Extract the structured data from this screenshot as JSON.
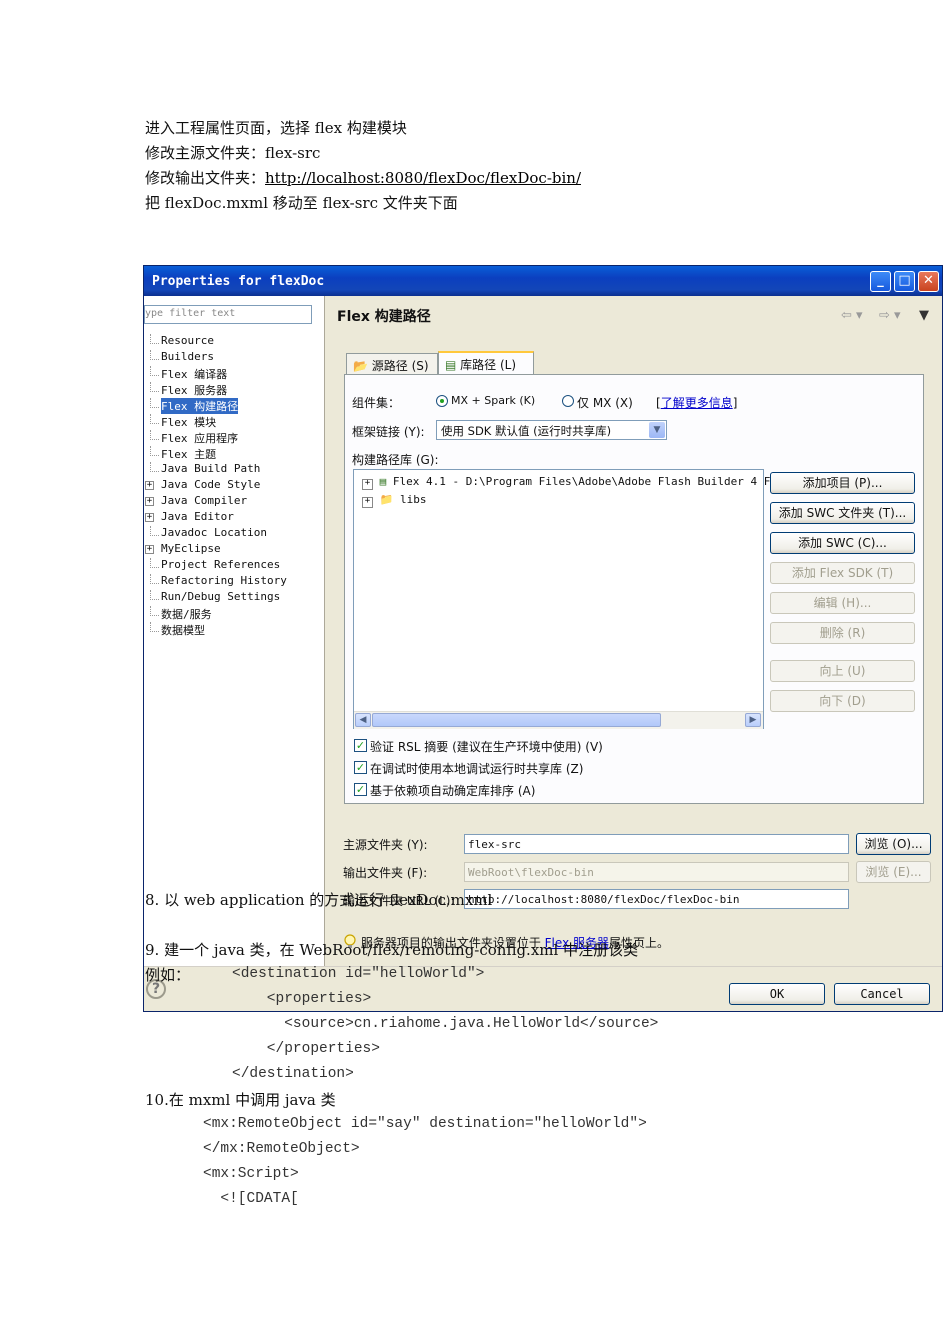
{
  "intro_lines": [
    "进入工程属性页面，选择 flex 构建模块",
    "修改主源文件夹：flex-src",
    "修改输出文件夹：",
    "把 flexDoc.mxml 移动至 flex-src 文件夹下面"
  ],
  "output_url": "http://localhost:8080/flexDoc/flexDoc-bin/",
  "dialog": {
    "title": "Properties for flexDoc",
    "filter_placeholder": "ype filter text",
    "tree": [
      {
        "label": "Resource",
        "expandable": false
      },
      {
        "label": "Builders",
        "expandable": false
      },
      {
        "label": "Flex 编译器",
        "expandable": false
      },
      {
        "label": "Flex 服务器",
        "expandable": false
      },
      {
        "label": "Flex 构建路径",
        "expandable": false,
        "selected": true
      },
      {
        "label": "Flex 模块",
        "expandable": false
      },
      {
        "label": "Flex 应用程序",
        "expandable": false
      },
      {
        "label": "Flex 主题",
        "expandable": false
      },
      {
        "label": "Java Build Path",
        "expandable": false
      },
      {
        "label": "Java Code Style",
        "expandable": true
      },
      {
        "label": "Java Compiler",
        "expandable": true
      },
      {
        "label": "Java Editor",
        "expandable": true
      },
      {
        "label": "Javadoc Location",
        "expandable": false
      },
      {
        "label": "MyEclipse",
        "expandable": true
      },
      {
        "label": "Project References",
        "expandable": false
      },
      {
        "label": "Refactoring History",
        "expandable": false
      },
      {
        "label": "Run/Debug Settings",
        "expandable": false
      },
      {
        "label": "数据/服务",
        "expandable": false
      },
      {
        "label": "数据模型",
        "expandable": false
      }
    ],
    "header": "Flex 构建路径",
    "tabs": [
      "源路径 (S)",
      "库路径 (L)"
    ],
    "component_set_label": "组件集：",
    "radio_mx_spark": "MX + Spark (K)",
    "radio_mx_only": "仅 MX (X)",
    "learn_more": "了解更多信息",
    "framework_link_label": "框架链接 (Y):",
    "framework_link_value": "使用 SDK 默认值 (运行时共享库)",
    "lib_label": "构建路径库 (G):",
    "lib_items": [
      "Flex 4.1 - D:\\Program Files\\Adobe\\Adobe Flash Builder 4 F",
      "libs"
    ],
    "buttons": [
      {
        "label": "添加项目 (P)...",
        "enabled": true
      },
      {
        "label": "添加 SWC 文件夹 (T)...",
        "enabled": true
      },
      {
        "label": "添加 SWC (C)...",
        "enabled": true
      },
      {
        "label": "添加 Flex SDK (T)",
        "enabled": false
      },
      {
        "label": "编辑 (H)...",
        "enabled": false
      },
      {
        "label": "删除 (R)",
        "enabled": false
      },
      {
        "label": "向上 (U)",
        "enabled": false
      },
      {
        "label": "向下 (D)",
        "enabled": false
      }
    ],
    "checkboxes": [
      "验证 RSL 摘要 (建议在生产环境中使用) (V)",
      "在调试时使用本地调试运行时共享库 (Z)",
      "基于依赖项自动确定库排序 (A)"
    ],
    "main_src_label": "主源文件夹 (Y):",
    "main_src_value": "flex-src",
    "browse1": "浏览 (O)...",
    "output_label": "输出文件夹 (F):",
    "output_value": "WebRoot\\flexDoc-bin",
    "browse2": "浏览 (E)...",
    "output_url_label": "输出文件夹 URL (L):",
    "output_url_value": "http://localhost:8080/flexDoc/flexDoc-bin",
    "server_note_pre": "服务器项目的输出文件夹设置位于 ",
    "server_note_link": "Flex 服务器",
    "server_note_post": "属性页上。",
    "ok": "OK",
    "cancel": "Cancel"
  },
  "step8": "8. 以 web application 的方式运行 flexDoc.mxml",
  "step9": "9. 建一个 java 类，在 WebRoot/flex/remoting-config.xml 中注册该类",
  "example_label": "例如：",
  "code1": [
    "<destination id=\"helloWorld\">",
    "    <properties>",
    "      <source>cn.riahome.java.HelloWorld</source>",
    "    </properties>",
    "</destination>"
  ],
  "step10": "10.在 mxml 中调用 java 类",
  "code2": [
    "<mx:RemoteObject id=\"say\" destination=\"helloWorld\">",
    "</mx:RemoteObject>",
    "<mx:Script>",
    "  <![CDATA["
  ]
}
